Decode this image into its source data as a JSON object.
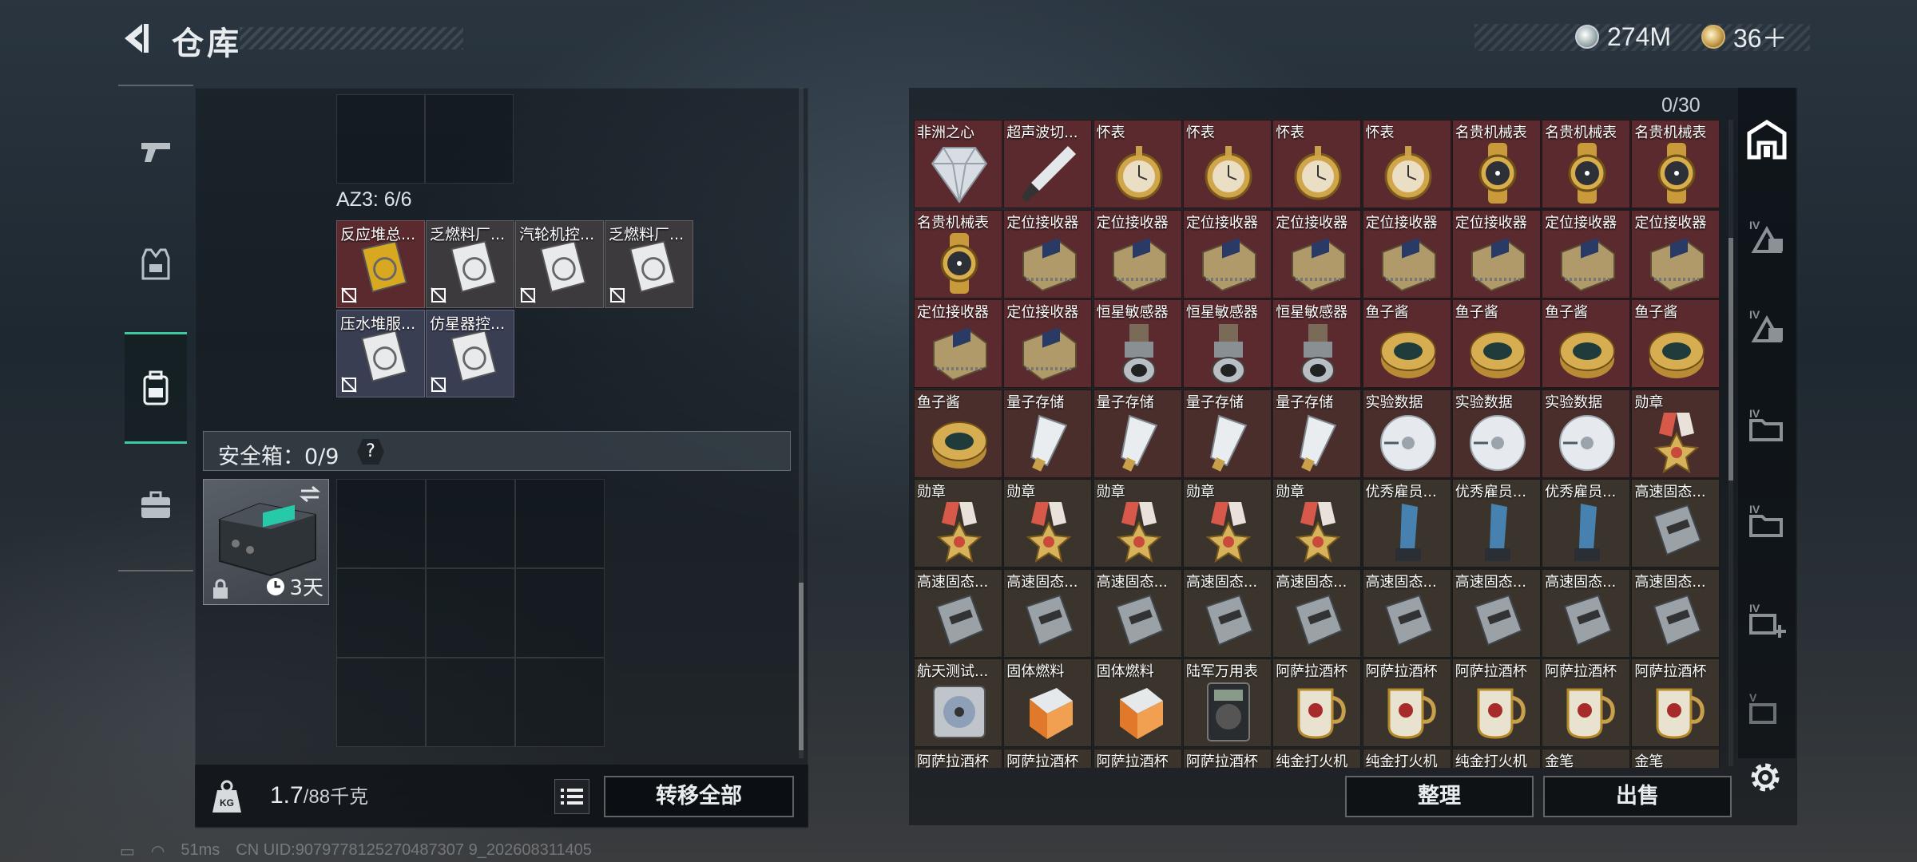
{
  "header": {
    "title": "仓库"
  },
  "currency": {
    "silver": "274M",
    "gold": "36＋"
  },
  "left_nav": [
    "weapon",
    "armor",
    "backpack",
    "case"
  ],
  "container": {
    "az3_label": "AZ3: 6/6",
    "items": [
      {
        "name": "反应堆总...",
        "bg": "#5a2a2e"
      },
      {
        "name": "乏燃料厂...",
        "bg": "#3d3a3e"
      },
      {
        "name": "汽轮机控...",
        "bg": "#3d3a3e"
      },
      {
        "name": "乏燃料厂...",
        "bg": "#3d3a3e"
      },
      {
        "name": "压水堆服...",
        "bg": "#3a3e52"
      },
      {
        "name": "仿星器控...",
        "bg": "#3a3e52"
      }
    ]
  },
  "safe": {
    "label": "安全箱：0/9",
    "help": "?",
    "timer": "3天"
  },
  "weight": {
    "current": "1.7",
    "max": "/88千克"
  },
  "buttons": {
    "transfer_all": "转移全部",
    "sort": "整理",
    "sell": "出售"
  },
  "stash_count": "0/30",
  "stash_rows": [
    [
      "非洲之心",
      "超声波切...",
      "怀表",
      "怀表",
      "怀表",
      "怀表",
      "名贵机械表",
      "名贵机械表",
      "名贵机械表"
    ],
    [
      "名贵机械表",
      "定位接收器",
      "定位接收器",
      "定位接收器",
      "定位接收器",
      "定位接收器",
      "定位接收器",
      "定位接收器",
      "定位接收器"
    ],
    [
      "定位接收器",
      "定位接收器",
      "恒星敏感器",
      "恒星敏感器",
      "恒星敏感器",
      "鱼子酱",
      "鱼子酱",
      "鱼子酱",
      "鱼子酱"
    ],
    [
      "鱼子酱",
      "量子存储",
      "量子存储",
      "量子存储",
      "量子存储",
      "实验数据",
      "实验数据",
      "实验数据",
      "勋章"
    ],
    [
      "勋章",
      "勋章",
      "勋章",
      "勋章",
      "勋章",
      "优秀雇员...",
      "优秀雇员...",
      "优秀雇员...",
      "高速固态..."
    ],
    [
      "高速固态...",
      "高速固态...",
      "高速固态...",
      "高速固态...",
      "高速固态...",
      "高速固态...",
      "高速固态...",
      "高速固态...",
      "高速固态..."
    ],
    [
      "航天测试...",
      "固体燃料",
      "固体燃料",
      "陆军万用表",
      "阿萨拉酒杯",
      "阿萨拉酒杯",
      "阿萨拉酒杯",
      "阿萨拉酒杯",
      "阿萨拉酒杯"
    ],
    [
      "阿萨拉酒杯",
      "阿萨拉酒杯",
      "阿萨拉酒杯",
      "阿萨拉酒杯",
      "纯金打火机",
      "纯金打火机",
      "纯金打火机",
      "金笔",
      "金笔"
    ]
  ],
  "status_bar": {
    "ping": "51ms",
    "uid": "CN UID:9079778125270487307 9_202608311405"
  }
}
